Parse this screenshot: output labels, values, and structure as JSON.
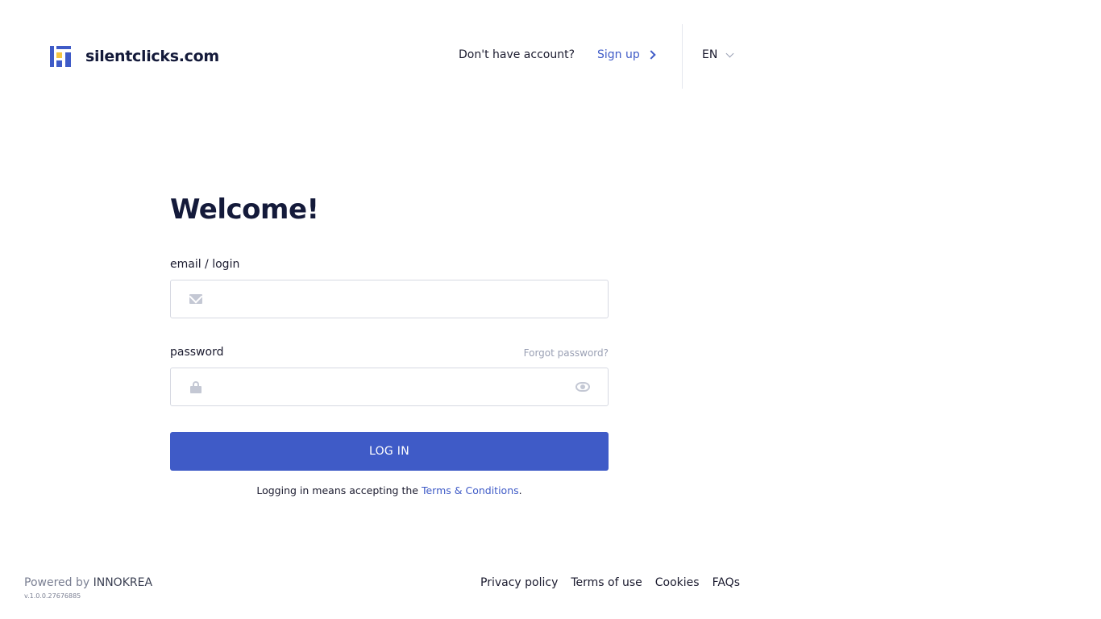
{
  "header": {
    "brand": "silentclicks.com",
    "account_prompt": "Don't have account?",
    "signup_label": "Sign up",
    "language": "EN"
  },
  "form": {
    "title": "Welcome!",
    "email_label": "email / login",
    "email_value": "",
    "password_label": "password",
    "password_value": "",
    "forgot_label": "Forgot password?",
    "login_label": "LOG IN",
    "terms_prefix": "Logging in means accepting the",
    "terms_link": "Terms & Conditions",
    "terms_suffix": "."
  },
  "footer": {
    "powered_prefix": "Powered by",
    "powered_brand": "INNOKREA",
    "version": "v.1.0.0.27676885",
    "links": {
      "privacy": "Privacy policy",
      "terms": "Terms of use",
      "cookies": "Cookies",
      "faqs": "FAQs"
    }
  },
  "colors": {
    "accent": "#3f5bc7",
    "logo_yellow": "#f4c542",
    "text_dark": "#141a3a"
  },
  "icons": [
    "mail-icon",
    "lock-icon",
    "eye-icon",
    "chevron-right-icon",
    "chevron-down-icon"
  ]
}
